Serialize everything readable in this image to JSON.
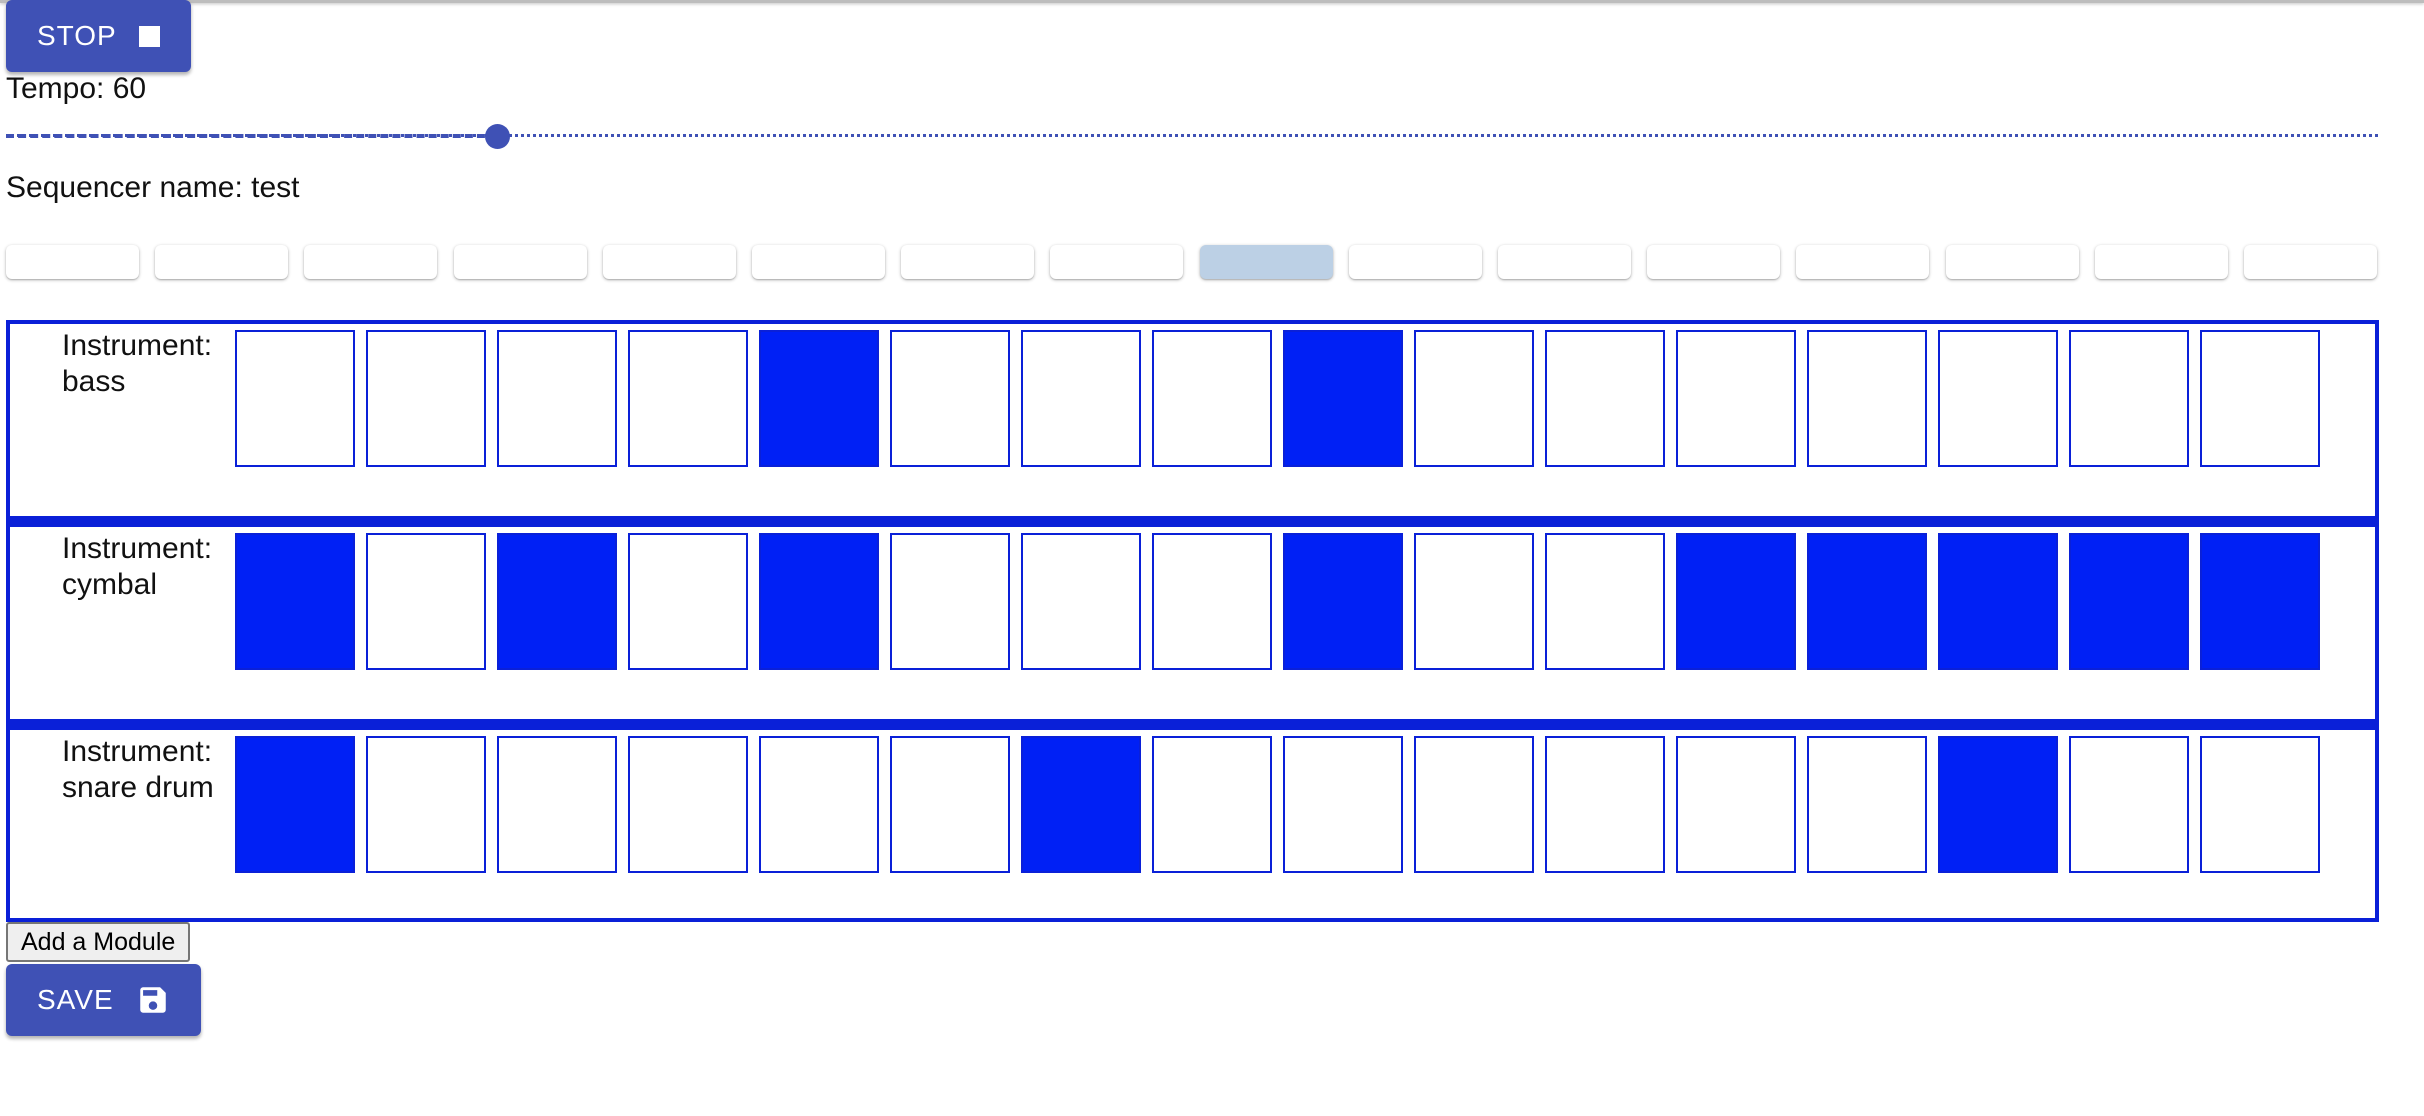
{
  "transport": {
    "stop_label": "STOP",
    "stop_icon": "stop-icon",
    "save_label": "SAVE",
    "save_icon": "floppy-disk-icon"
  },
  "tempo": {
    "label": "Tempo: 60",
    "value": 60,
    "slider_fraction": 0.207
  },
  "sequencer": {
    "name_label": "Sequencer name: test",
    "step_count": 16,
    "current_step": 9
  },
  "modules": [
    {
      "label": "Instrument: bass",
      "steps": [
        0,
        0,
        0,
        0,
        1,
        0,
        0,
        0,
        1,
        0,
        0,
        0,
        0,
        0,
        0,
        0
      ]
    },
    {
      "label": "Instrument: cymbal",
      "steps": [
        1,
        0,
        1,
        0,
        1,
        0,
        0,
        0,
        1,
        0,
        0,
        1,
        1,
        1,
        1,
        1
      ]
    },
    {
      "label": "Instrument: snare drum",
      "steps": [
        1,
        0,
        0,
        0,
        0,
        0,
        1,
        0,
        0,
        0,
        0,
        0,
        0,
        1,
        0,
        0
      ]
    }
  ],
  "add_module_label": "Add a Module",
  "colors": {
    "primary": "#3f51b5",
    "step_on": "#0020f5",
    "module_border": "#0a20d8",
    "current_step_highlight": "#bcd0e5"
  }
}
